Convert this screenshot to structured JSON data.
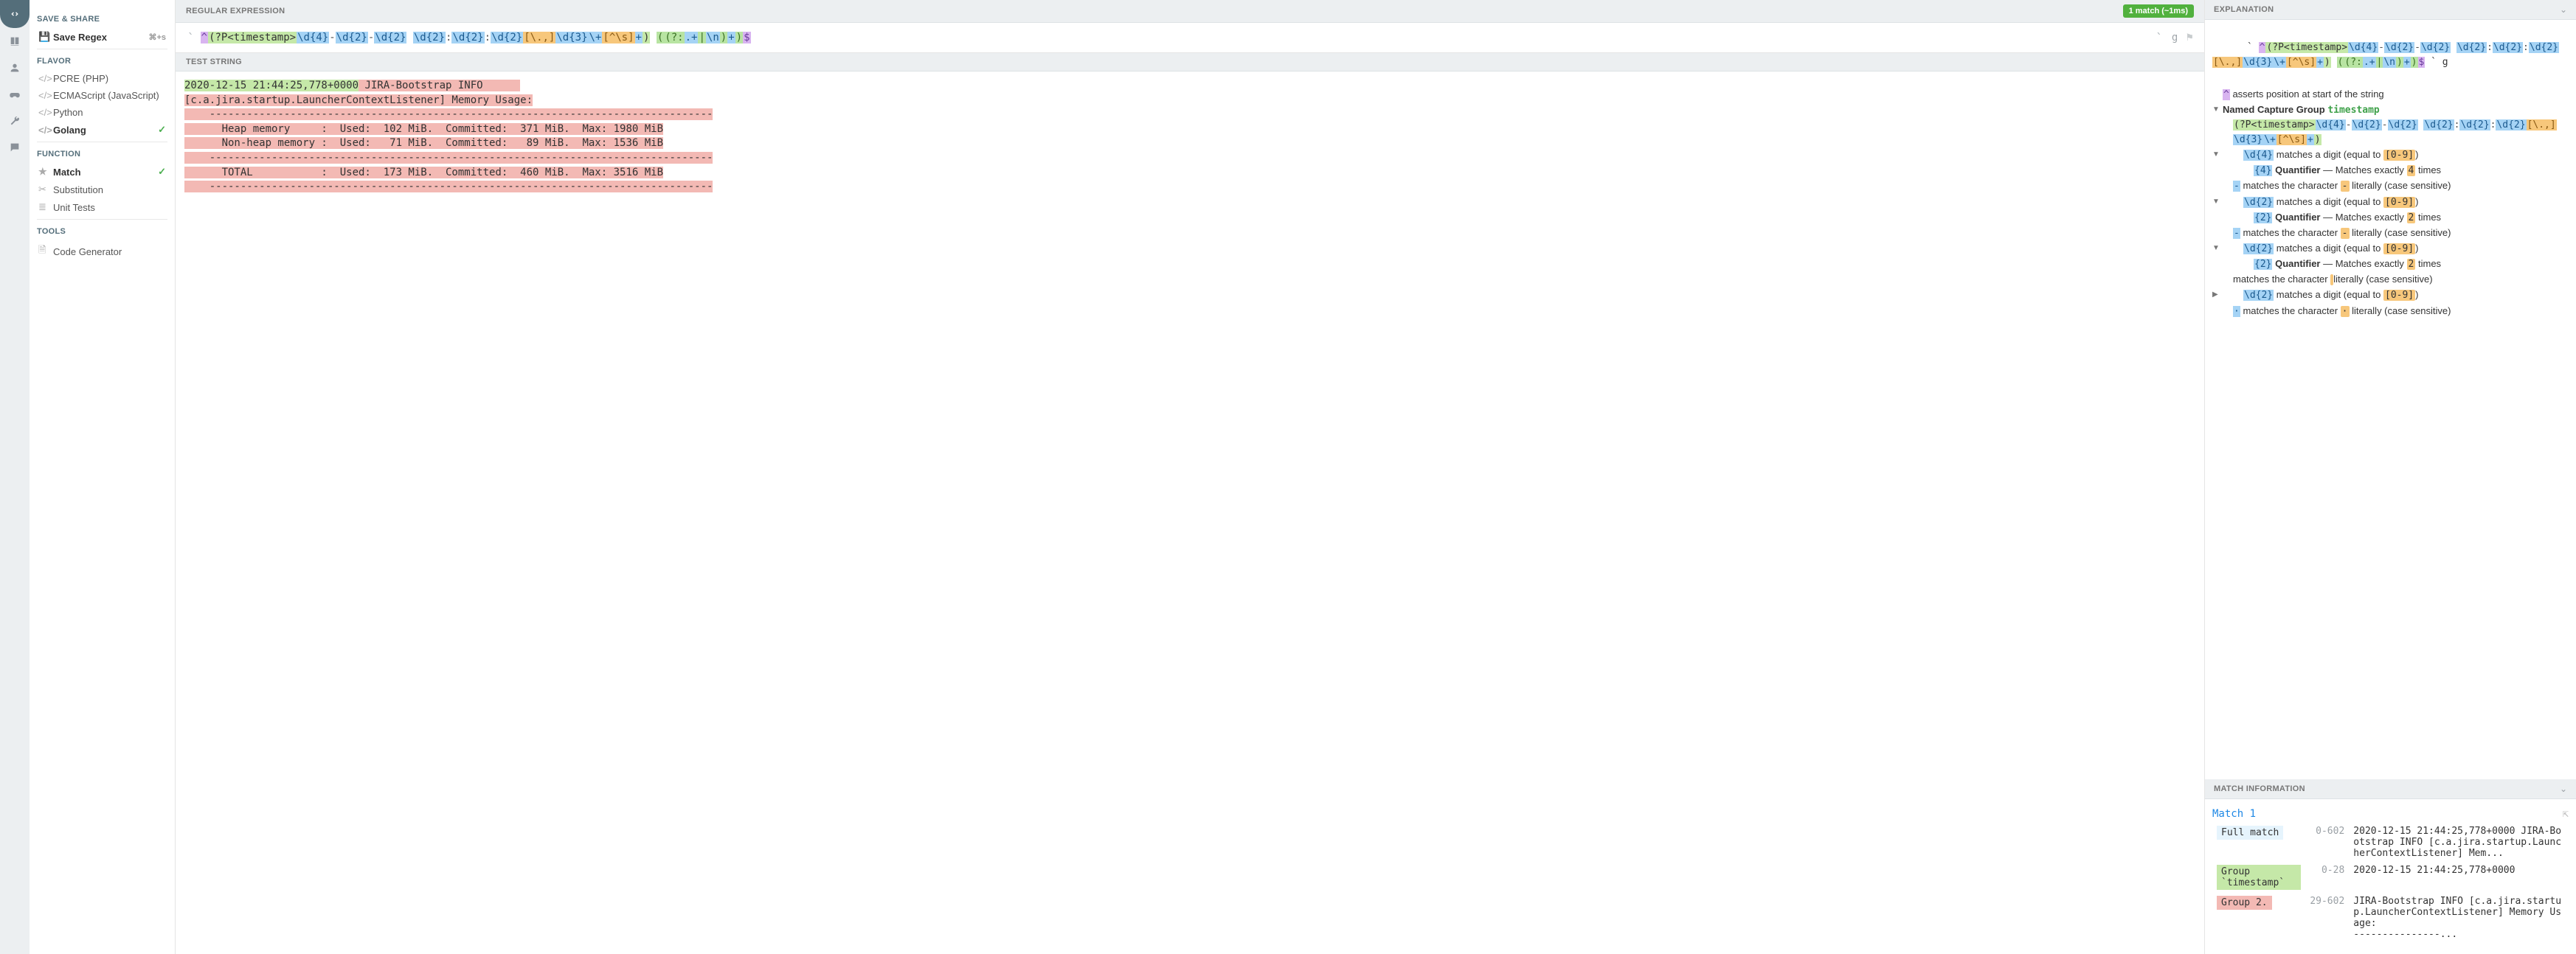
{
  "iconbar": [
    "code",
    "book",
    "user",
    "gamepad",
    "wrench",
    "chat"
  ],
  "sidebar": {
    "save_share": "SAVE & SHARE",
    "save_regex": "Save Regex",
    "save_kbd": "⌘+s",
    "flavor": "FLAVOR",
    "flavors": [
      {
        "label": "PCRE (PHP)",
        "sel": false
      },
      {
        "label": "ECMAScript (JavaScript)",
        "sel": false
      },
      {
        "label": "Python",
        "sel": false
      },
      {
        "label": "Golang",
        "sel": true
      }
    ],
    "function": "FUNCTION",
    "functions": [
      {
        "label": "Match",
        "sel": true,
        "icon": "star"
      },
      {
        "label": "Substitution",
        "sel": false,
        "icon": "scissors"
      },
      {
        "label": "Unit Tests",
        "sel": false,
        "icon": "list"
      }
    ],
    "tools": "TOOLS",
    "tool_items": [
      {
        "label": "Code Generator",
        "icon": "file"
      }
    ]
  },
  "center": {
    "regex_title": "REGULAR EXPRESSION",
    "match_badge": "1 match (~1ms)",
    "delim": "`",
    "flags": "g",
    "regex_tokens": [
      {
        "t": "^",
        "c": "tk-anch"
      },
      {
        "t": "(?P<timestamp>",
        "c": "tk-bgrp"
      },
      {
        "t": "\\d{4}",
        "c": "tk-esc"
      },
      {
        "t": "-",
        "c": "tk-lit"
      },
      {
        "t": "\\d{2}",
        "c": "tk-esc"
      },
      {
        "t": "-",
        "c": "tk-lit"
      },
      {
        "t": "\\d{2}",
        "c": "tk-esc"
      },
      {
        "t": " ",
        "c": "tk-lit"
      },
      {
        "t": "\\d{2}",
        "c": "tk-esc"
      },
      {
        "t": ":",
        "c": "tk-lit"
      },
      {
        "t": "\\d{2}",
        "c": "tk-esc"
      },
      {
        "t": ":",
        "c": "tk-lit"
      },
      {
        "t": "\\d{2}",
        "c": "tk-esc"
      },
      {
        "t": "[\\.,]",
        "c": "tk-cls"
      },
      {
        "t": "\\d{3}",
        "c": "tk-esc"
      },
      {
        "t": "\\+",
        "c": "tk-esc"
      },
      {
        "t": "[^\\s]",
        "c": "tk-cls"
      },
      {
        "t": "+",
        "c": "tk-esc"
      },
      {
        "t": ")",
        "c": "tk-bgrp"
      },
      {
        "t": " ",
        "c": "tk-lit"
      },
      {
        "t": "(",
        "c": "tk-grp"
      },
      {
        "t": "(?:",
        "c": "tk-grp"
      },
      {
        "t": ".+",
        "c": "tk-esc"
      },
      {
        "t": "|",
        "c": "tk-grp"
      },
      {
        "t": "\\n",
        "c": "tk-esc"
      },
      {
        "t": ")",
        "c": "tk-grp"
      },
      {
        "t": "+",
        "c": "tk-esc"
      },
      {
        "t": ")",
        "c": "tk-grp"
      },
      {
        "t": "$",
        "c": "tk-anch"
      }
    ],
    "test_title": "TEST STRING",
    "test_lines": [
      {
        "ts": "2020-12-15 21:44:25,778+0000",
        "rest": " JIRA-Bootstrap INFO      "
      },
      {
        "ts": "",
        "rest": "[c.a.jira.startup.LauncherContextListener] Memory Usage:"
      },
      {
        "ts": "",
        "rest": "    ---------------------------------------------------------------------------------"
      },
      {
        "ts": "",
        "rest": "      Heap memory     :  Used:  102 MiB.  Committed:  371 MiB.  Max: 1980 MiB"
      },
      {
        "ts": "",
        "rest": "      Non-heap memory :  Used:   71 MiB.  Committed:   89 MiB.  Max: 1536 MiB"
      },
      {
        "ts": "",
        "rest": "    ---------------------------------------------------------------------------------"
      },
      {
        "ts": "",
        "rest": "      TOTAL           :  Used:  173 MiB.  Committed:  460 MiB.  Max: 3516 MiB"
      },
      {
        "ts": "",
        "rest": "    ---------------------------------------------------------------------------------"
      }
    ]
  },
  "right": {
    "explanation_title": "EXPLANATION",
    "regex_header_tokens": [
      {
        "t": "^",
        "c": "tk-anch"
      },
      {
        "t": "(?P<timestamp>",
        "c": "tk-bgrp"
      },
      {
        "t": "\\d{4}",
        "c": "tk-esc"
      },
      {
        "t": "-",
        "c": "tk-lit"
      },
      {
        "t": "\\d{2}",
        "c": "tk-esc"
      },
      {
        "t": "-",
        "c": "tk-lit"
      },
      {
        "t": "\\d{2}",
        "c": "tk-esc"
      },
      {
        "t": " ",
        "c": "tk-lit"
      },
      {
        "t": "\\d{2}",
        "c": "tk-esc"
      },
      {
        "t": ":",
        "c": "tk-lit"
      },
      {
        "t": "\\d{2}",
        "c": "tk-esc"
      },
      {
        "t": ":",
        "c": "tk-lit"
      },
      {
        "t": "\\d{2}",
        "c": "tk-esc"
      },
      {
        "t": "[\\.,]",
        "c": "tk-cls"
      },
      {
        "t": "\\d{3}",
        "c": "tk-esc"
      },
      {
        "t": "\\+",
        "c": "tk-esc"
      },
      {
        "t": "[^\\s]",
        "c": "tk-cls"
      },
      {
        "t": "+",
        "c": "tk-esc"
      },
      {
        "t": ")",
        "c": "tk-bgrp"
      },
      {
        "t": " ",
        "c": ""
      },
      {
        "t": "(",
        "c": "tk-grp"
      },
      {
        "t": "(?:",
        "c": "tk-grp"
      },
      {
        "t": ".+",
        "c": "tk-esc"
      },
      {
        "t": "|",
        "c": "tk-grp"
      },
      {
        "t": "\\n",
        "c": "tk-esc"
      },
      {
        "t": ")",
        "c": "tk-grp"
      },
      {
        "t": "+",
        "c": "tk-esc"
      },
      {
        "t": ")",
        "c": "tk-grp"
      },
      {
        "t": "$",
        "c": "tk-anch"
      }
    ],
    "exp_delim_l": "`",
    "exp_delim_r": "` g",
    "exp_assert": "asserts position at start of the string",
    "exp_caret": "^",
    "ncg_label": "Named Capture Group",
    "ncg_name": "timestamp",
    "ncg_tokens": [
      {
        "t": "(?P<timestamp>",
        "c": "tk-bgrp"
      },
      {
        "t": "\\d{4}",
        "c": "tk-esc"
      },
      {
        "t": "-",
        "c": "tk-lit"
      },
      {
        "t": "\\d{2}",
        "c": "tk-esc"
      },
      {
        "t": "-",
        "c": "tk-lit"
      },
      {
        "t": "\\d{2}",
        "c": "tk-esc"
      },
      {
        "t": " ",
        "c": ""
      },
      {
        "t": "\\d{2}",
        "c": "tk-esc"
      },
      {
        "t": ":",
        "c": "tk-lit"
      },
      {
        "t": "\\d{2}",
        "c": "tk-esc"
      },
      {
        "t": ":",
        "c": "tk-lit"
      },
      {
        "t": "\\d{2}",
        "c": "tk-esc"
      },
      {
        "t": "[\\.,]",
        "c": "tk-cls"
      },
      {
        "t": "\\d{3}",
        "c": "tk-esc"
      },
      {
        "t": "\\+",
        "c": "tk-esc"
      },
      {
        "t": "[^\\s]",
        "c": "tk-cls"
      },
      {
        "t": "+",
        "c": "tk-esc"
      },
      {
        "t": ")",
        "c": "tk-bgrp"
      }
    ],
    "tree": [
      {
        "lvl": 2,
        "toggle": "▼",
        "code": "\\d{4}",
        "txt": " matches a digit (equal to ",
        "hl": "[0-9]",
        "tail": ")"
      },
      {
        "lvl": 3,
        "toggle": "",
        "code": "{4}",
        "bold": " Quantifier",
        "txt": " — Matches exactly ",
        "hl": "4",
        "tail": " times"
      },
      {
        "lvl": 1,
        "toggle": "",
        "code": "-",
        "txt": " matches the character ",
        "hl": "-",
        "tail": " literally (case sensitive)"
      },
      {
        "lvl": 2,
        "toggle": "▼",
        "code": "\\d{2}",
        "txt": " matches a digit (equal to ",
        "hl": "[0-9]",
        "tail": ")"
      },
      {
        "lvl": 3,
        "toggle": "",
        "code": "{2}",
        "bold": " Quantifier",
        "txt": " — Matches exactly ",
        "hl": "2",
        "tail": " times"
      },
      {
        "lvl": 1,
        "toggle": "",
        "code": "-",
        "txt": " matches the character ",
        "hl": "-",
        "tail": " literally (case sensitive)"
      },
      {
        "lvl": 2,
        "toggle": "▼",
        "code": "\\d{2}",
        "txt": " matches a digit (equal to ",
        "hl": "[0-9]",
        "tail": ")"
      },
      {
        "lvl": 3,
        "toggle": "",
        "code": "{2}",
        "bold": " Quantifier",
        "txt": " — Matches exactly ",
        "hl": "2",
        "tail": " times"
      },
      {
        "lvl": 1,
        "toggle": "",
        "code": "",
        "txt": "matches the character ",
        "hl": " ",
        "tail": " literally (case sensitive)"
      },
      {
        "lvl": 2,
        "toggle": "▶",
        "code": "\\d{2}",
        "txt": " matches a digit (equal to ",
        "hl": "[0-9]",
        "tail": ")"
      },
      {
        "lvl": 1,
        "toggle": "",
        "code": "·",
        "txt": " matches the character ",
        "hl": "·",
        "tail": " literally (case sensitive)"
      }
    ],
    "match_info_title": "MATCH INFORMATION",
    "match1": "Match 1",
    "rows": [
      {
        "g": "Full match",
        "cls": "",
        "range": "0-602",
        "val": "2020-12-15 21:44:25,778+0000 JIRA-Bootstrap INFO      [c.a.jira.startup.LauncherContextListener] Mem..."
      },
      {
        "g": "Group `timestamp`",
        "cls": "g1",
        "range": "0-28",
        "val": "2020-12-15 21:44:25,778+0000"
      },
      {
        "g": "Group 2.",
        "cls": "g2",
        "range": "29-602",
        "val": "JIRA-Bootstrap INFO      [c.a.jira.startup.LauncherContextListener] Memory Usage:\n    ---------------..."
      }
    ]
  }
}
